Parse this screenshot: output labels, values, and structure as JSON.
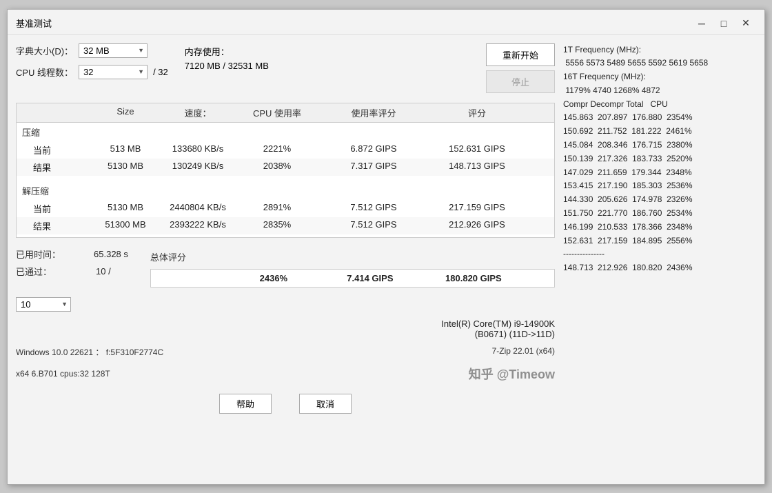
{
  "window": {
    "title": "基准测试",
    "controls": {
      "minimize": "─",
      "maximize": "□",
      "close": "✕"
    }
  },
  "topControls": {
    "dictLabel": "字典大小(D)：",
    "dictValue": "32 MB",
    "memoryLabel": "内存使用：",
    "memoryValue": "7120 MB / 32531 MB",
    "cpuThreadsLabel": "CPU 线程数：",
    "cpuThreadsValue": "32",
    "cpuThreadsMax": "/ 32",
    "btnStart": "重新开始",
    "btnStop": "停止"
  },
  "tableHeaders": {
    "col0": "",
    "col1": "Size",
    "col2": "速度：",
    "col3": "CPU 使用率",
    "col4": "使用率评分",
    "col5": "评分"
  },
  "compression": {
    "sectionLabel": "压缩",
    "rows": [
      {
        "label": "当前",
        "size": "513 MB",
        "speed": "133680 KB/s",
        "cpuUsage": "2221%",
        "ratingUsage": "6.872 GIPS",
        "rating": "152.631 GIPS"
      },
      {
        "label": "结果",
        "size": "5130 MB",
        "speed": "130249 KB/s",
        "cpuUsage": "2038%",
        "ratingUsage": "7.317 GIPS",
        "rating": "148.713 GIPS"
      }
    ]
  },
  "decompression": {
    "sectionLabel": "解压缩",
    "rows": [
      {
        "label": "当前",
        "size": "5130 MB",
        "speed": "2440804 KB/s",
        "cpuUsage": "2891%",
        "ratingUsage": "7.512 GIPS",
        "rating": "217.159 GIPS"
      },
      {
        "label": "结果",
        "size": "51300 MB",
        "speed": "2393222 KB/s",
        "cpuUsage": "2835%",
        "ratingUsage": "7.512 GIPS",
        "rating": "212.926 GIPS"
      }
    ]
  },
  "stats": {
    "timeLabel": "已用时间：",
    "timeValue": "65.328 s",
    "passedLabel": "已通过：",
    "passedValue": "10 /",
    "totalLabel": "总体评分"
  },
  "totalScores": {
    "cpuUsage": "2436%",
    "ratingUsage": "7.414 GIPS",
    "rating": "180.820 GIPS"
  },
  "passedSelect": "10",
  "bottomInfo": {
    "osInfo": "Windows 10.0 22621 ： f:5F310F2774C",
    "archInfo": "x64 6.B701 cpus:32 128T",
    "cpuName": "Intel(R) Core(TM) i9-14900K",
    "cpuDetail": "(B0671) (11D->11D)",
    "appVersion": "7-Zip 22.01 (x64)",
    "btnHelp": "帮助",
    "btnCancel": "取消"
  },
  "watermark": "知乎 @Timeow",
  "rightPanel": {
    "line1": "1T Frequency (MHz):",
    "line2": " 5556 5573 5489 5655 5592 5619 5658",
    "line3": "16T Frequency (MHz):",
    "line4": " 1179% 4740 1268% 4872",
    "line5": "Compr Decompr Total   CPU",
    "rows": [
      "145.863  207.897  176.880  2354%",
      "150.692  211.752  181.222  2461%",
      "145.084  208.346  176.715  2380%",
      "150.139  217.326  183.733  2520%",
      "147.029  211.659  179.344  2348%",
      "153.415  217.190  185.303  2536%",
      "144.330  205.626  174.978  2326%",
      "151.750  221.770  186.760  2534%",
      "146.199  210.533  178.366  2348%",
      "152.631  217.159  184.895  2556%"
    ],
    "separator": "---------------",
    "totalRow": "148.713  212.926  180.820  2436%"
  }
}
